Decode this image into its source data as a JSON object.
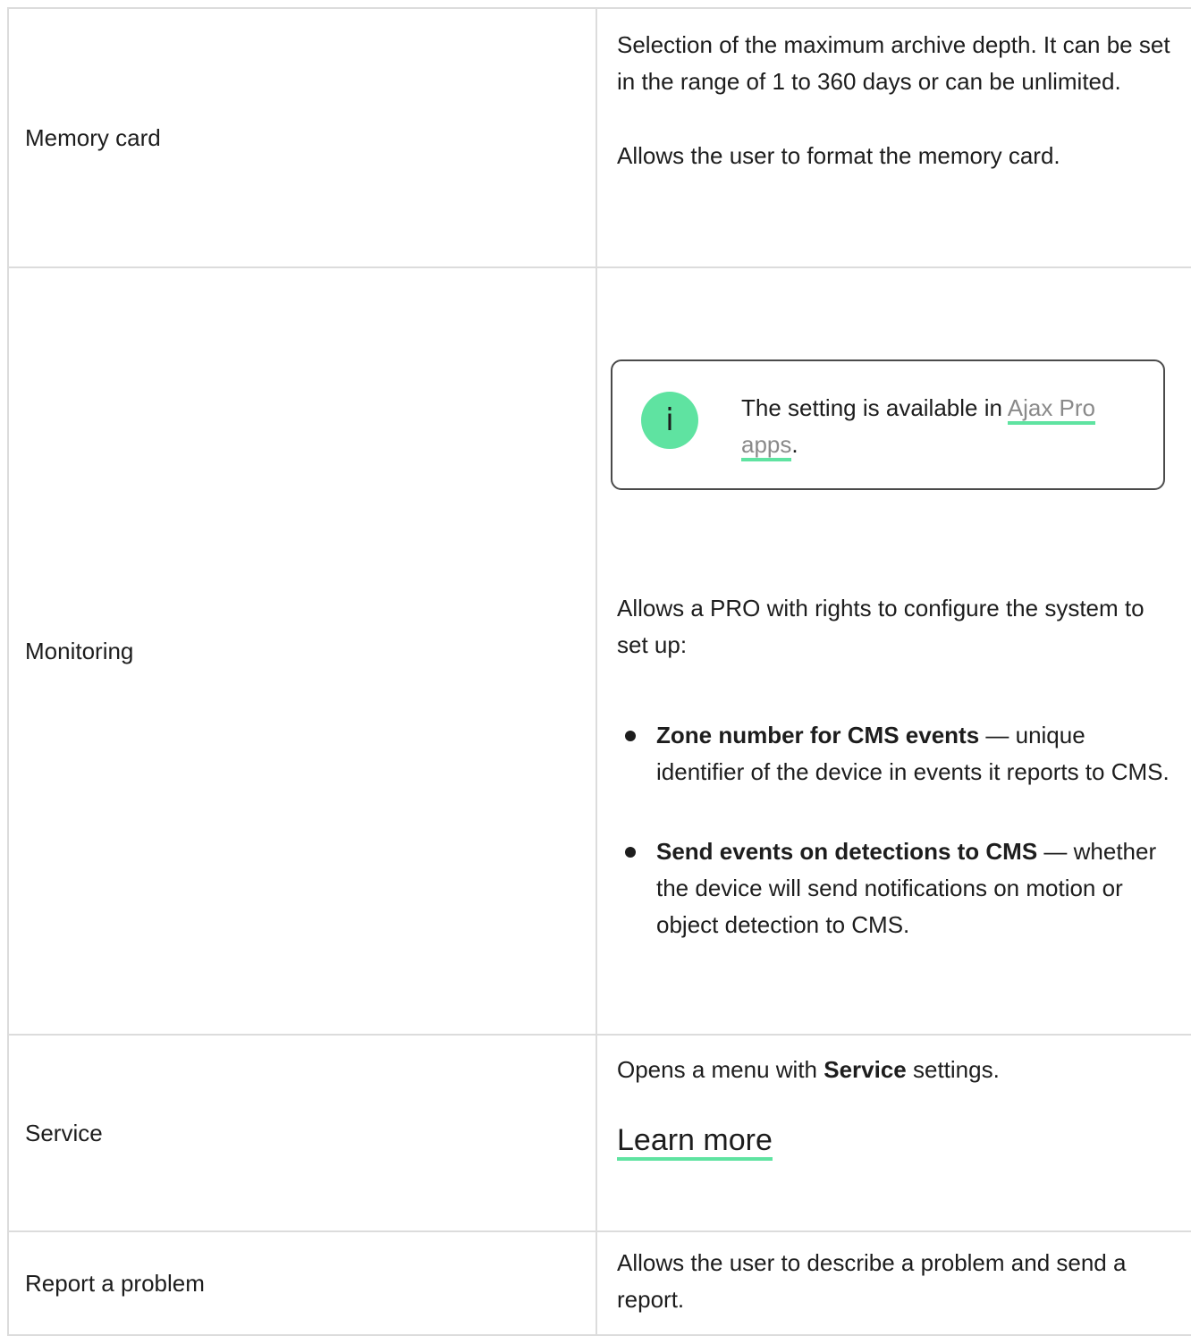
{
  "rows": [
    {
      "label": "Memory card",
      "p1": "Selection of the maximum archive depth. It can be set in the range of 1 to 360 days or can be unlimited.",
      "p2": "Allows the user to format the memory card."
    },
    {
      "label": "Monitoring",
      "info": {
        "icon": "info-icon",
        "glyph": "i",
        "text_before": "The setting is available in ",
        "link": "Ajax Pro apps",
        "text_after": "."
      },
      "intro": "Allows a PRO with rights to configure the system to set up:",
      "bullets": [
        {
          "bold": "Zone number for CMS events",
          "rest": " — unique identifier of the device in events it reports to CMS."
        },
        {
          "bold": "Send events on detections to CMS",
          "rest": " — whether the device will send notifications on motion or object detection to CMS."
        }
      ]
    },
    {
      "label": "Service",
      "text_before": "Opens a menu with ",
      "bold": "Service",
      "text_after": " settings.",
      "learn_more": "Learn more"
    },
    {
      "label": "Report a problem",
      "text": "Allows the user to describe a problem and send a report."
    }
  ],
  "colors": {
    "accent": "#5fe3a1",
    "border": "#dcdcdc",
    "link": "#8a8a8a",
    "text": "#1d1d1d"
  }
}
